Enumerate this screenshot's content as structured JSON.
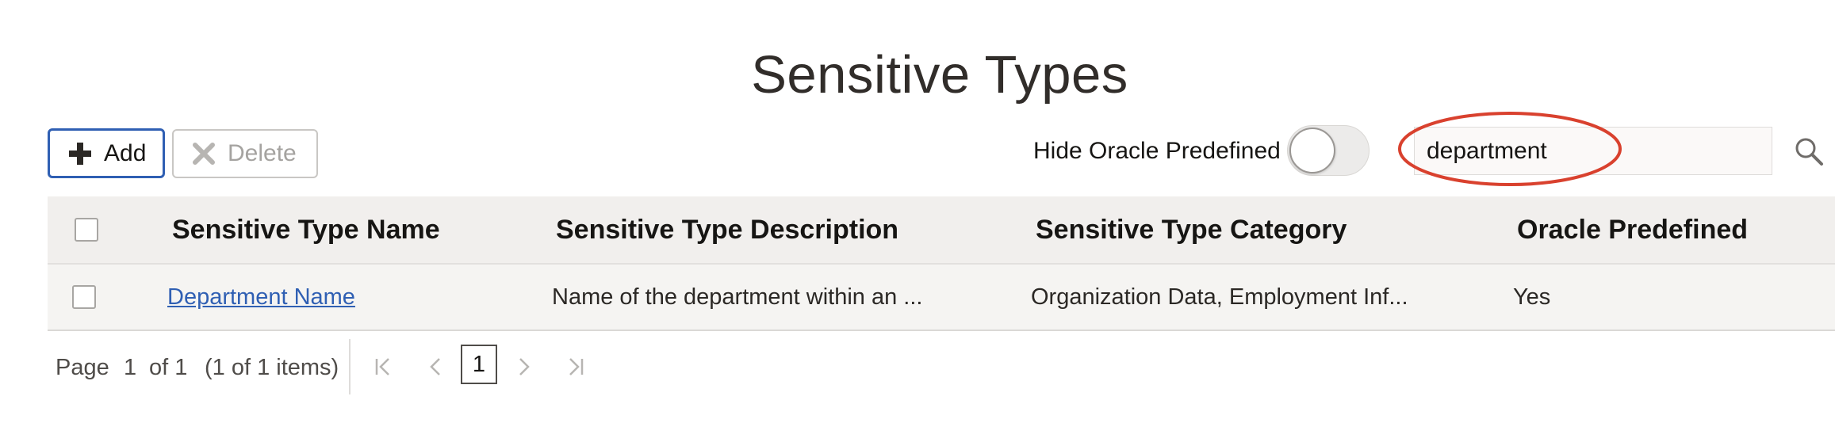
{
  "page": {
    "title": "Sensitive Types"
  },
  "toolbar": {
    "add_label": "Add",
    "delete_label": "Delete",
    "add_icon": "plus-icon",
    "delete_icon": "x-icon"
  },
  "filter": {
    "toggle_label": "Hide Oracle Predefined",
    "toggle_on": false,
    "search_value": "department",
    "search_icon": "search-icon",
    "highlight_color": "#d9412e"
  },
  "table": {
    "columns": [
      "Sensitive Type Name",
      "Sensitive Type Description",
      "Sensitive Type Category",
      "Oracle Predefined"
    ],
    "rows": [
      {
        "name": "Department Name",
        "description": "Name of the department within an ...",
        "category": "Organization Data, Employment Inf...",
        "predefined": "Yes"
      }
    ]
  },
  "pagination": {
    "page_label": "Page",
    "current_page": "1",
    "of_label": "of 1",
    "items_label": "(1 of 1 items)",
    "page_number": "1"
  },
  "colors": {
    "accent": "#2f5fb3",
    "annotation": "#d9412e"
  }
}
